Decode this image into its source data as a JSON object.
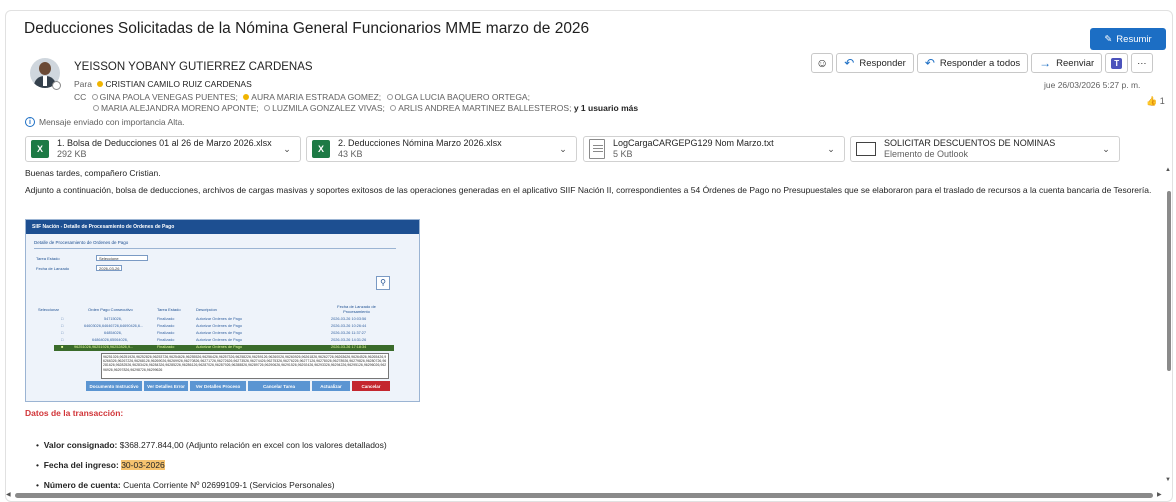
{
  "header": {
    "subject": "Deducciones Solicitadas de la Nómina General Funcionarios MME marzo de 2026",
    "summarize_label": "Resumir"
  },
  "sender": {
    "name": "YEISSON YOBANY GUTIERREZ CARDENAS",
    "to_label": "Para",
    "to": "CRISTIAN CAMILO RUIZ CARDENAS",
    "cc_label": "CC",
    "cc_line1": [
      "GINA PAOLA VENEGAS PUENTES;",
      "AURA MARIA ESTRADA GOMEZ;",
      "OLGA LUCIA BAQUERO ORTEGA;"
    ],
    "cc_line2": [
      "MARIA ALEJANDRA MORENO APONTE;",
      "LUZMILA GONZALEZ VIVAS;",
      "ARLIS ANDREA MARTINEZ BALLESTEROS;"
    ],
    "more": "y 1 usuario más",
    "importance": "Mensaje enviado con importancia Alta."
  },
  "actions": {
    "reply": "Responder",
    "reply_all": "Responder a todos",
    "forward": "Reenviar",
    "date": "jue 26/03/2026 5:27 p. m.",
    "likes": "1"
  },
  "attachments": [
    {
      "name": "1. Bolsa de Deducciones 01 al 26 de Marzo 2026.xlsx",
      "size": "292 KB",
      "icon": "excel-icon"
    },
    {
      "name": "2. Deducciones Nómina Marzo 2026.xlsx",
      "size": "43 KB",
      "icon": "excel-icon"
    },
    {
      "name": "LogCargaCARGEPG129 Nom Marzo.txt",
      "size": "5 KB",
      "icon": "text-file-icon"
    },
    {
      "name": "SOLICITAR DESCUENTOS DE NOMINAS",
      "size": "Elemento de Outlook",
      "icon": "mail-icon"
    }
  ],
  "body": {
    "greeting": "Buenas tardes, compañero Cristian.",
    "paragraph": "Adjunto a continuación, bolsa de deducciones, archivos de cargas masivas y soportes exitosos de las operaciones generadas en el aplicativo SIIF Nación II, correspondientes a 54 Órdenes de Pago no Presupuestales que se elaboraron para el traslado de recursos a la cuenta bancaria de Tesorería.",
    "section_title": "Datos de la transacción:",
    "items": [
      {
        "label": "Valor consignado:",
        "value": " $368.277.844,00 (Adjunto relación en excel con los valores detallados)"
      },
      {
        "label": "Fecha del ingreso:",
        "value": "30-03-2026"
      },
      {
        "label": "Número de cuenta:",
        "value": " Cuenta Corriente Nº 02699109-1 (Servicios Personales)"
      }
    ]
  },
  "embedded": {
    "title": "SIIF Nación - Detalle de Procesamiento de Ordenes de Pago",
    "subtitle": "Detalle de Procesamiento de Ordenes de Pago",
    "estado_label": "Tarea Estado",
    "estado_value": "Seleccione",
    "fecha_label": "Fecha de Lanzado",
    "fecha_value": "2026-03-26",
    "columns": [
      "Seleccionar",
      "Orden Pago Consecutivo",
      "Tarea Estado",
      "Descripcion",
      "Fecha de Lanzado de Procesamiento"
    ],
    "rows": [
      [
        "54715026,",
        "Finalizado",
        "Autorizar Ordenes de Pago",
        "2026-03-26 10:03:56"
      ],
      [
        "64603026,64646726,64690426,6...",
        "Finalizado",
        "Autorizar Ordenes de Pago",
        "2026-03-26 10:26:44"
      ],
      [
        "64854026,",
        "Finalizado",
        "Autorizar Ordenes de Pago",
        "2026-03-26 11:37:27"
      ],
      [
        "64864026,65064026,",
        "Finalizado",
        "Autorizar Ordenes de Pago",
        "2026-03-26 14:31:26"
      ],
      [
        "96251026,96251926,96252826,9...",
        "Finalizado",
        "Autorizar Ordenes de Pago",
        "2026-03-26 17:18:34"
      ]
    ],
    "tooltip": "96251026,96251926,96252826,96253726,96254626,96255526,96256426,96257326,96258226,96259126,96260026,96260926,96261826,96262726,96263626,96264526,96265426,96266326,96267226,96268126,96269026,96269926,96270826,96271726,96272626,96273526,96274426,96275326,96276226,96277126,96278026,96278926,96279826,96280726,96281626,96282526,96283426,96284326,96285226,96286126,96287026,96287926,96288826,96289726,96290626,96291526,96292426,96293326,96294226,96295126,96296026,96296926,96297826,96298726,96299626",
    "buttons": [
      "Documento Instructivo",
      "Ver Detalles Error",
      "Ver Detalles Proceso",
      "Cancelar Tarea",
      "Actualizar",
      "Cancelar"
    ]
  }
}
